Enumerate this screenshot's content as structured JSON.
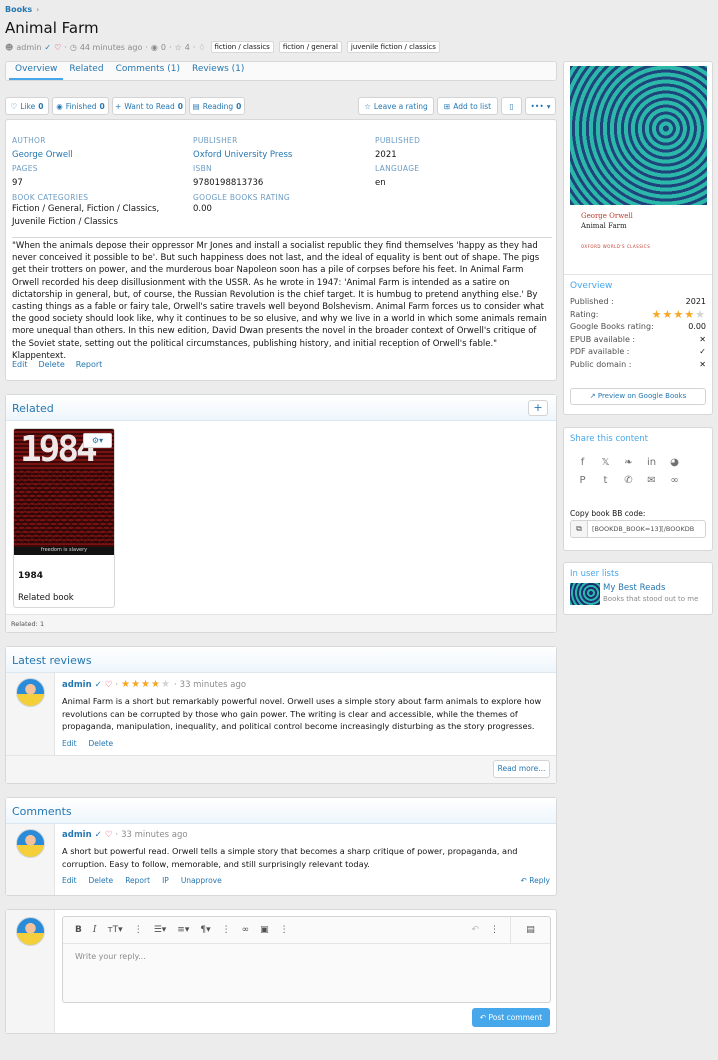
{
  "breadcrumb": {
    "label": "Books"
  },
  "page": {
    "title": "Animal Farm"
  },
  "meta": {
    "author": "admin",
    "time": "44 minutes ago",
    "views": "0",
    "likes": "4",
    "tags": [
      "fiction / classics",
      "fiction / general",
      "juvenile fiction / classics"
    ]
  },
  "tabs": [
    "Overview",
    "Related",
    "Comments (1)",
    "Reviews (1)"
  ],
  "actions": {
    "like": "Like",
    "like_count": "0",
    "finished": "Finished",
    "finished_count": "0",
    "want": "Want to Read",
    "want_count": "0",
    "reading": "Reading",
    "reading_count": "0",
    "rate": "Leave a rating",
    "addlist": "Add to list",
    "more": "•••"
  },
  "details": {
    "author_label": "Author",
    "author": "George Orwell",
    "publisher_label": "Publisher",
    "publisher": "Oxford University Press",
    "published_label": "Published",
    "published": "2021",
    "pages_label": "Pages",
    "pages": "97",
    "isbn_label": "ISBN",
    "isbn": "9780198813736",
    "language_label": "Language",
    "language": "en",
    "categories_label": "Book categories",
    "categories": "Fiction / General, Fiction / Classics, Juvenile Fiction / Classics",
    "grating_label": "Google Books rating",
    "grating": "0.00"
  },
  "description": "\"When the animals depose their oppressor Mr Jones and install a socialist republic they find themselves 'happy as they had never conceived it possible to be'. But such happiness does not last, and the ideal of equality is bent out of shape. The pigs get their trotters on power, and the murderous boar Napoleon soon has a pile of corpses before his feet. In Animal Farm Orwell recorded his deep disillusionment with the USSR. As he wrote in 1947: 'Animal Farm is intended as a satire on dictatorship in general, but, of course, the Russian Revolution is the chief target. It is humbug to pretend anything else.' By casting things as a fable or fairy tale, Orwell's satire travels well beyond Bolshevism. Animal Farm forces us to consider what the good society should look like, why it continues to be so elusive, and why we live in a world in which some animals remain more unequal than others. In this new edition, David Dwan presents the novel in the broader context of Orwell's critique of the Soviet state, setting out the political circumstances, publishing history, and initial reception of Orwell's fable.\" Klappentext.",
  "desc_links": [
    "Edit",
    "Delete",
    "Report"
  ],
  "related": {
    "title": "Related",
    "add": "+",
    "book_cover_text": "1984",
    "book_cover_foot": "freedom is slavery",
    "book_title": "1984",
    "book_sub": "Related book",
    "footer": "Related: 1"
  },
  "reviews": {
    "title": "Latest reviews",
    "user": "admin",
    "rating": 4,
    "time": "33 minutes ago",
    "text": "Animal Farm is a short but remarkably powerful novel. Orwell uses a simple story about farm animals to explore how revolutions can be corrupted by those who gain power. The writing is clear and accessible, while the themes of propaganda, manipulation, inequality, and political control become increasingly disturbing as the story progresses.",
    "links": [
      "Edit",
      "Delete"
    ],
    "more": "Read more..."
  },
  "comments": {
    "title": "Comments",
    "user": "admin",
    "time": "33 minutes ago",
    "text": "A short but powerful read. Orwell tells a simple story that becomes a sharp critique of power, propaganda, and corruption. Easy to follow, memorable, and still surprisingly relevant today.",
    "links": [
      "Edit",
      "Delete",
      "Report",
      "IP",
      "Unapprove"
    ],
    "reply": "Reply"
  },
  "editor": {
    "placeholder": "Write your reply...",
    "post": "Post comment"
  },
  "sidebar": {
    "cover_author": "George Orwell",
    "cover_title": "Animal Farm",
    "cover_publisher": "OXFORD WORLD'S CLASSICS",
    "overview_title": "Overview",
    "published_label": "Published :",
    "published": "2021",
    "rating_label": "Rating:",
    "rating": 4,
    "grating_label": "Google Books rating:",
    "grating": "0.00",
    "epub_label": "EPUB available :",
    "epub": "✕",
    "pdf_label": "PDF available :",
    "pdf": "✓",
    "pd_label": "Public domain :",
    "pd": "✕",
    "preview": "Preview on Google Books",
    "share_title": "Share this content",
    "copy_label": "Copy book BB code:",
    "copy_value": "[BOOKDB_BOOK=13][/BOOKDB",
    "lists_title": "In user lists",
    "list_name": "My Best Reads",
    "list_desc": "Books that stood out to me"
  },
  "colors": {
    "accent": "#2577b1",
    "star": "#f5a623",
    "heart": "#e0245e",
    "button": "#47a7eb"
  }
}
